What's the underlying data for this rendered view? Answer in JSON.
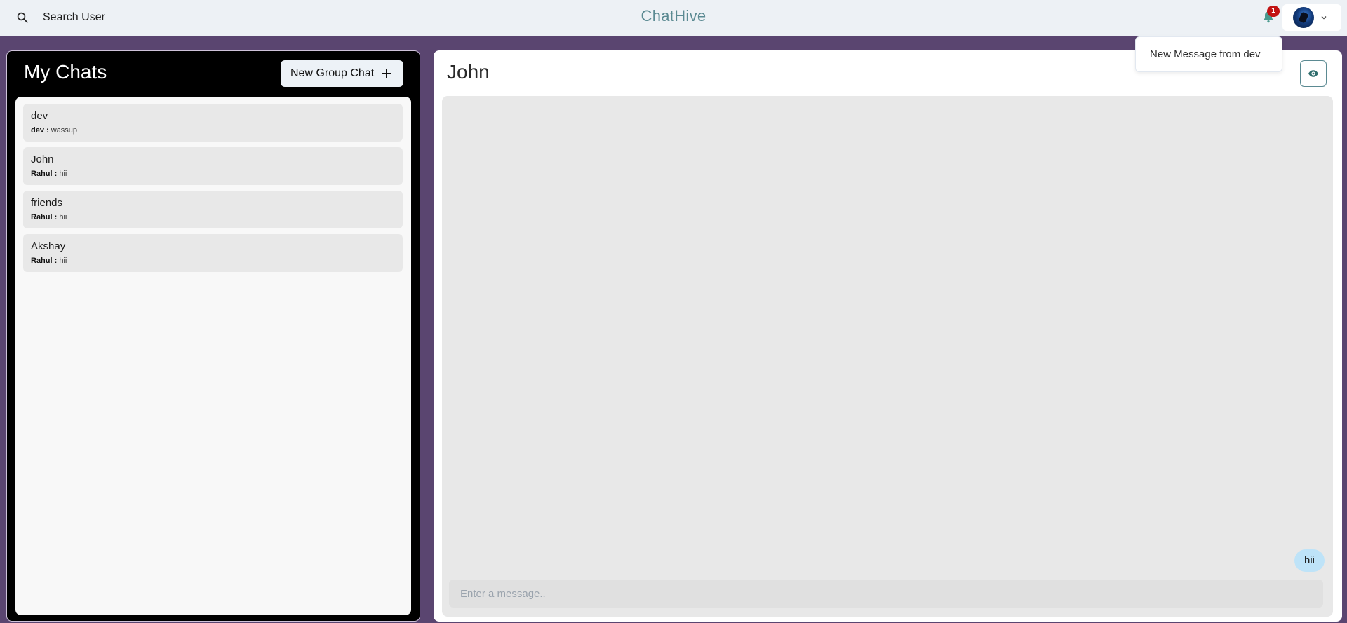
{
  "topbar": {
    "search_label": "Search User",
    "brand": "ChatHive",
    "notification_count": "1",
    "notification_menu": [
      "New Message from dev"
    ]
  },
  "sidebar": {
    "title": "My Chats",
    "new_group_label": "New Group Chat",
    "chats": [
      {
        "name": "dev",
        "sender": "dev :",
        "message": "wassup"
      },
      {
        "name": "John",
        "sender": "Rahul :",
        "message": "hii"
      },
      {
        "name": "friends",
        "sender": "Rahul :",
        "message": "hii"
      },
      {
        "name": "Akshay",
        "sender": "Rahul :",
        "message": "hii"
      }
    ]
  },
  "chat": {
    "title": "John",
    "messages": [
      {
        "text": "hii"
      }
    ],
    "input_placeholder": "Enter a message.."
  },
  "colors": {
    "brand": "#5b8a92",
    "background": "#5a4570",
    "badge": "#c21313",
    "bubble": "#bee3f8"
  }
}
